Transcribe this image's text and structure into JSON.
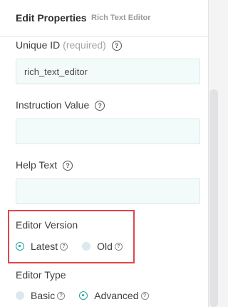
{
  "header": {
    "title": "Edit Properties",
    "subtitle": "Rich Text Editor"
  },
  "unique_id": {
    "label": "Unique ID",
    "required": "(required)",
    "value": "rich_text_editor"
  },
  "instruction_value": {
    "label": "Instruction Value",
    "value": ""
  },
  "help_text": {
    "label": "Help Text",
    "value": ""
  },
  "editor_version": {
    "label": "Editor Version",
    "options": [
      {
        "label": "Latest",
        "selected": true
      },
      {
        "label": "Old",
        "selected": false
      }
    ]
  },
  "editor_type": {
    "label": "Editor Type",
    "options": [
      {
        "label": "Basic",
        "selected": false
      },
      {
        "label": "Advanced",
        "selected": true
      }
    ]
  },
  "help_glyph": "?",
  "colors": {
    "accent": "#1fa49a",
    "highlight": "#e0464a",
    "field_bg": "#f3fafa"
  }
}
